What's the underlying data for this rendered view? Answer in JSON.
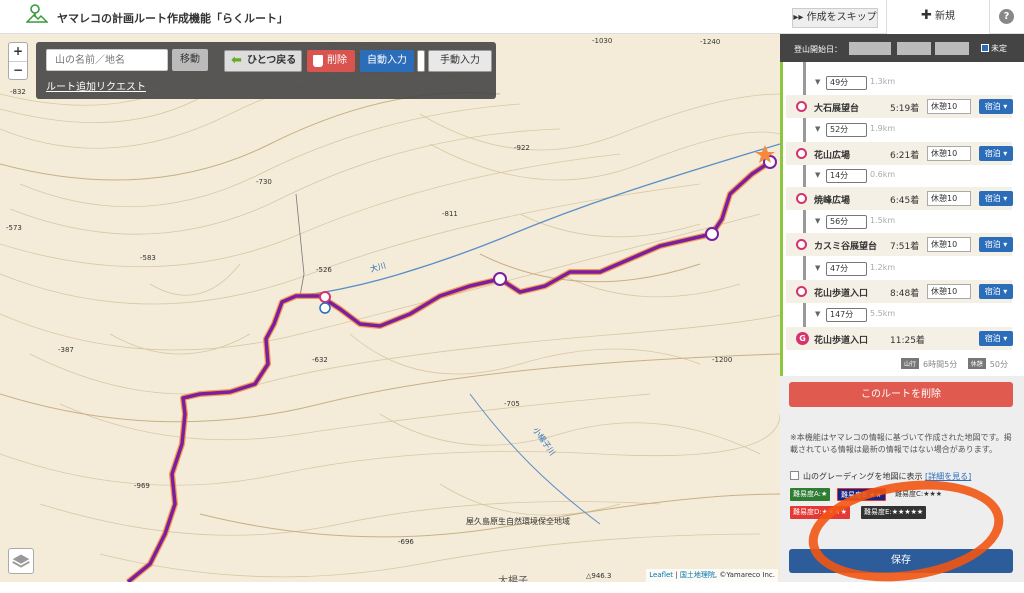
{
  "header": {
    "app_title": "ヤマレコの計画ルート作成機能「らくルート」",
    "skip_label": "作成をスキップ",
    "new_label": "新規",
    "help_label": "?"
  },
  "map": {
    "zoom_in": "+",
    "zoom_out": "−",
    "search_placeholder": "山の名前／地名",
    "move_label": "移動",
    "undo_label": "ひとつ戻る",
    "delete_label": "削除",
    "auto_label": "自動入力",
    "manual_label": "手動入力",
    "route_request": "ルート追加リクエスト",
    "elevations": [
      "-832",
      "-1030",
      "-730",
      "-922",
      "-573",
      "-583",
      "-811",
      "-526",
      "-387",
      "-632",
      "-705",
      "-1200",
      "-969",
      "-696",
      "△946.3",
      "-1240"
    ],
    "place_labels": [
      "大川",
      "小楊子川",
      "屋久島原生自然環境保全地域",
      "大楊子"
    ],
    "attribution": {
      "leaflet": "Leaflet",
      "gsi": "国土地理院",
      "yamareco": "©Yamareco Inc."
    },
    "route_color": "#7b1fa2"
  },
  "panel": {
    "date_label": "登山開始日：",
    "undecided_label": "未定",
    "waypoints": [
      {
        "name": "大石展望台",
        "time": "5:19着",
        "rest": "休憩10",
        "stay": "宿泊"
      },
      {
        "name": "花山広場",
        "time": "6:21着",
        "rest": "休憩10",
        "stay": "宿泊"
      },
      {
        "name": "焼峰広場",
        "time": "6:45着",
        "rest": "休憩10",
        "stay": "宿泊"
      },
      {
        "name": "カスミ谷展望台",
        "time": "7:51着",
        "rest": "休憩10",
        "stay": "宿泊"
      },
      {
        "name": "花山歩道入口",
        "time": "8:48着",
        "rest": "休憩10",
        "stay": "宿泊"
      },
      {
        "name": "花山歩道入口",
        "time": "11:25着",
        "rest": "",
        "stay": "宿泊",
        "goal": "G"
      }
    ],
    "segments": [
      {
        "min": "49分",
        "km": "1.3km"
      },
      {
        "min": "52分",
        "km": "1.9km"
      },
      {
        "min": "14分",
        "km": "0.6km"
      },
      {
        "min": "56分",
        "km": "1.5km"
      },
      {
        "min": "47分",
        "km": "1.2km"
      },
      {
        "min": "147分",
        "km": "5.5km"
      }
    ],
    "summary": {
      "hike_tag": "山行",
      "hike_time": "6時間5分",
      "rest_tag": "休憩",
      "rest_time": "50分"
    },
    "delete_route_label": "このルートを削除",
    "notice": "※本機能はヤマレコの情報に基づいて作成された地図です。掲載されている情報は最新の情報ではない場合があります。",
    "grading_label": "山のグレーディングを地図に表示",
    "grading_link": "[詳細を見る]",
    "badges": [
      {
        "label": "難易度A:★",
        "color": "#2e7d32"
      },
      {
        "label": "難易度B:★★",
        "color": "#1a237e"
      },
      {
        "label": "難易度C:★★★",
        "color": "#eeeeee"
      },
      {
        "label": "難易度D:★★★★",
        "color": "#e53935"
      },
      {
        "label": "難易度E:★★★★★",
        "color": "#333333"
      }
    ],
    "save_label": "保存"
  }
}
